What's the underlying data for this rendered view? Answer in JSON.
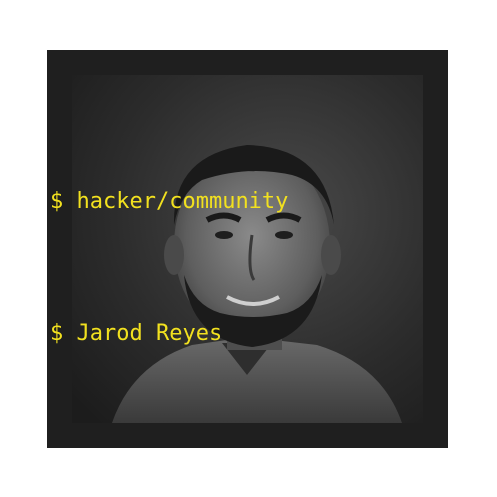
{
  "terminal": {
    "prompt": "$",
    "lines": [
      "hacker/community",
      "Jarod Reyes"
    ]
  },
  "photo": {
    "subject": "Jarod Reyes",
    "style": "grayscale portrait"
  },
  "colors": {
    "outer_background": "#ffffff",
    "frame": "#1f1f1f",
    "terminal_text": "#f2e11f",
    "photo_tint": "#2b2b2b"
  }
}
